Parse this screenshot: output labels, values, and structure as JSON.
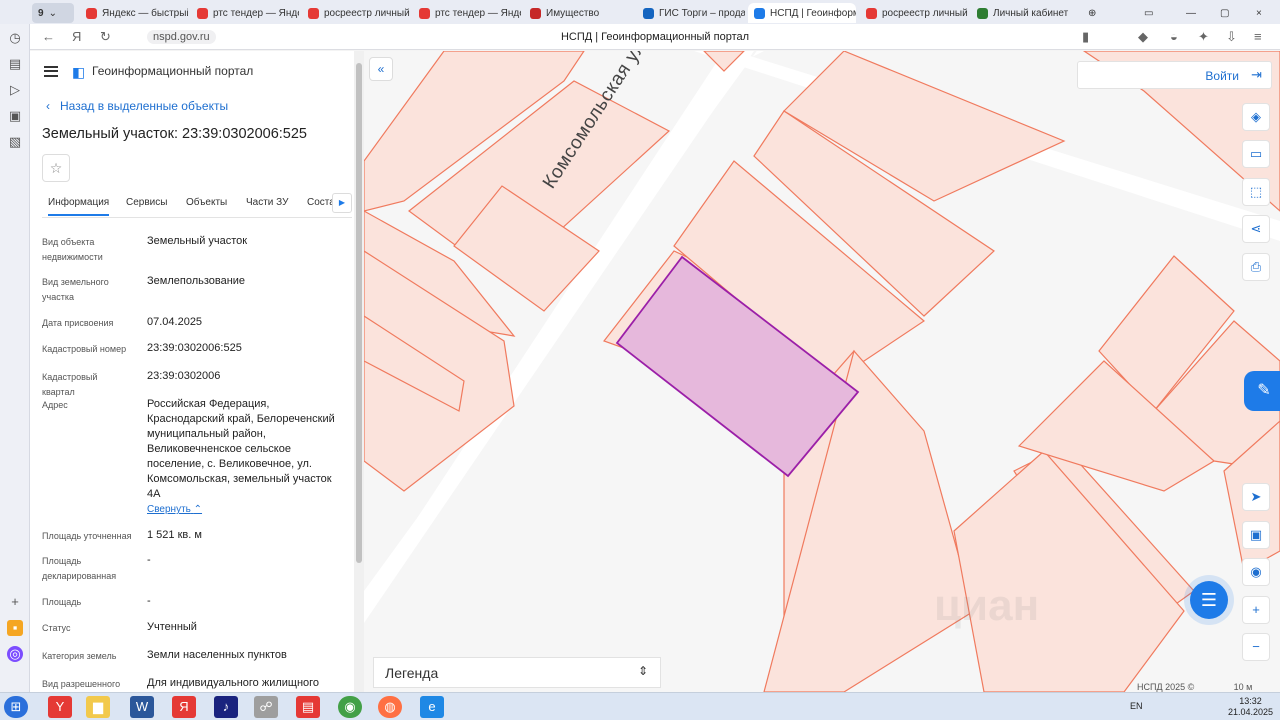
{
  "browser": {
    "tabs": [
      {
        "label": "Яндекс — быстрый",
        "color": "#e53935"
      },
      {
        "label": "ртс тендер — Яндекс",
        "color": "#e53935"
      },
      {
        "label": "росреестр личный к",
        "color": "#e53935"
      },
      {
        "label": "ртс тендер — Яндекс",
        "color": "#e53935"
      },
      {
        "label": "Имущество",
        "color": "#c62828"
      },
      {
        "label": "ГИС Торги – продаж",
        "color": "#1565c0"
      },
      {
        "label": "НСПД | Геоинформ",
        "color": "#1e7be8"
      },
      {
        "label": "росреестр личный к",
        "color": "#e53935"
      },
      {
        "label": "Личный кабинет",
        "color": "#2e7d32"
      }
    ],
    "address": "nspd.gov.ru",
    "page_title": "НСПД | Геоинформационный портал",
    "profile_label": "Войти"
  },
  "panel": {
    "portal_name": "Геоинформационный портал",
    "back_link": "Назад в выделенные объекты",
    "title": "Земельный участок: 23:39:0302006:525",
    "tabs": [
      "Информация",
      "Сервисы",
      "Объекты",
      "Части ЗУ",
      "Соста"
    ],
    "rows": [
      {
        "label": "Вид объекта недвижимости",
        "value": "Земельный участок"
      },
      {
        "label": "Вид земельного участка",
        "value": "Землепользование"
      },
      {
        "label": "Дата присвоения",
        "value": "07.04.2025"
      },
      {
        "label": "Кадастровый номер",
        "value": "23:39:0302006:525"
      },
      {
        "label": "Кадастровый квартал",
        "value": "23:39:0302006"
      },
      {
        "label": "Адрес",
        "value": "Российская Федерация, Краснодарский край, Белореченский муниципальный район, Великовечненское сельское поселение, с. Великовечное, ул. Комсомольская, земельный участок 4А"
      },
      {
        "label": "Площадь уточненная",
        "value": "1 521 кв. м"
      },
      {
        "label": "Площадь декларированная",
        "value": "-"
      },
      {
        "label": "Площадь",
        "value": "-"
      },
      {
        "label": "Статус",
        "value": "Учтенный"
      },
      {
        "label": "Категория земель",
        "value": "Земли населенных пунктов"
      },
      {
        "label": "Вид разрешенного",
        "value": "Для индивидуального жилищного"
      }
    ],
    "collapse_link": "Свернуть"
  },
  "map": {
    "street": "Комсомольская улица",
    "login": "Войти",
    "legend": "Легенда",
    "copyright": "НСПД 2025 ©",
    "scale": "10 м",
    "watermark": "циан",
    "colors": {
      "parcel_fill": "#fbe3dc",
      "parcel_stroke": "#f07a5e",
      "selected_fill": "#e6b8dc",
      "selected_stroke": "#9b1fa8",
      "road": "#ffffff"
    }
  },
  "taskbar": {
    "lang": "EN",
    "time": "13:32",
    "date": "21.04.2025"
  }
}
